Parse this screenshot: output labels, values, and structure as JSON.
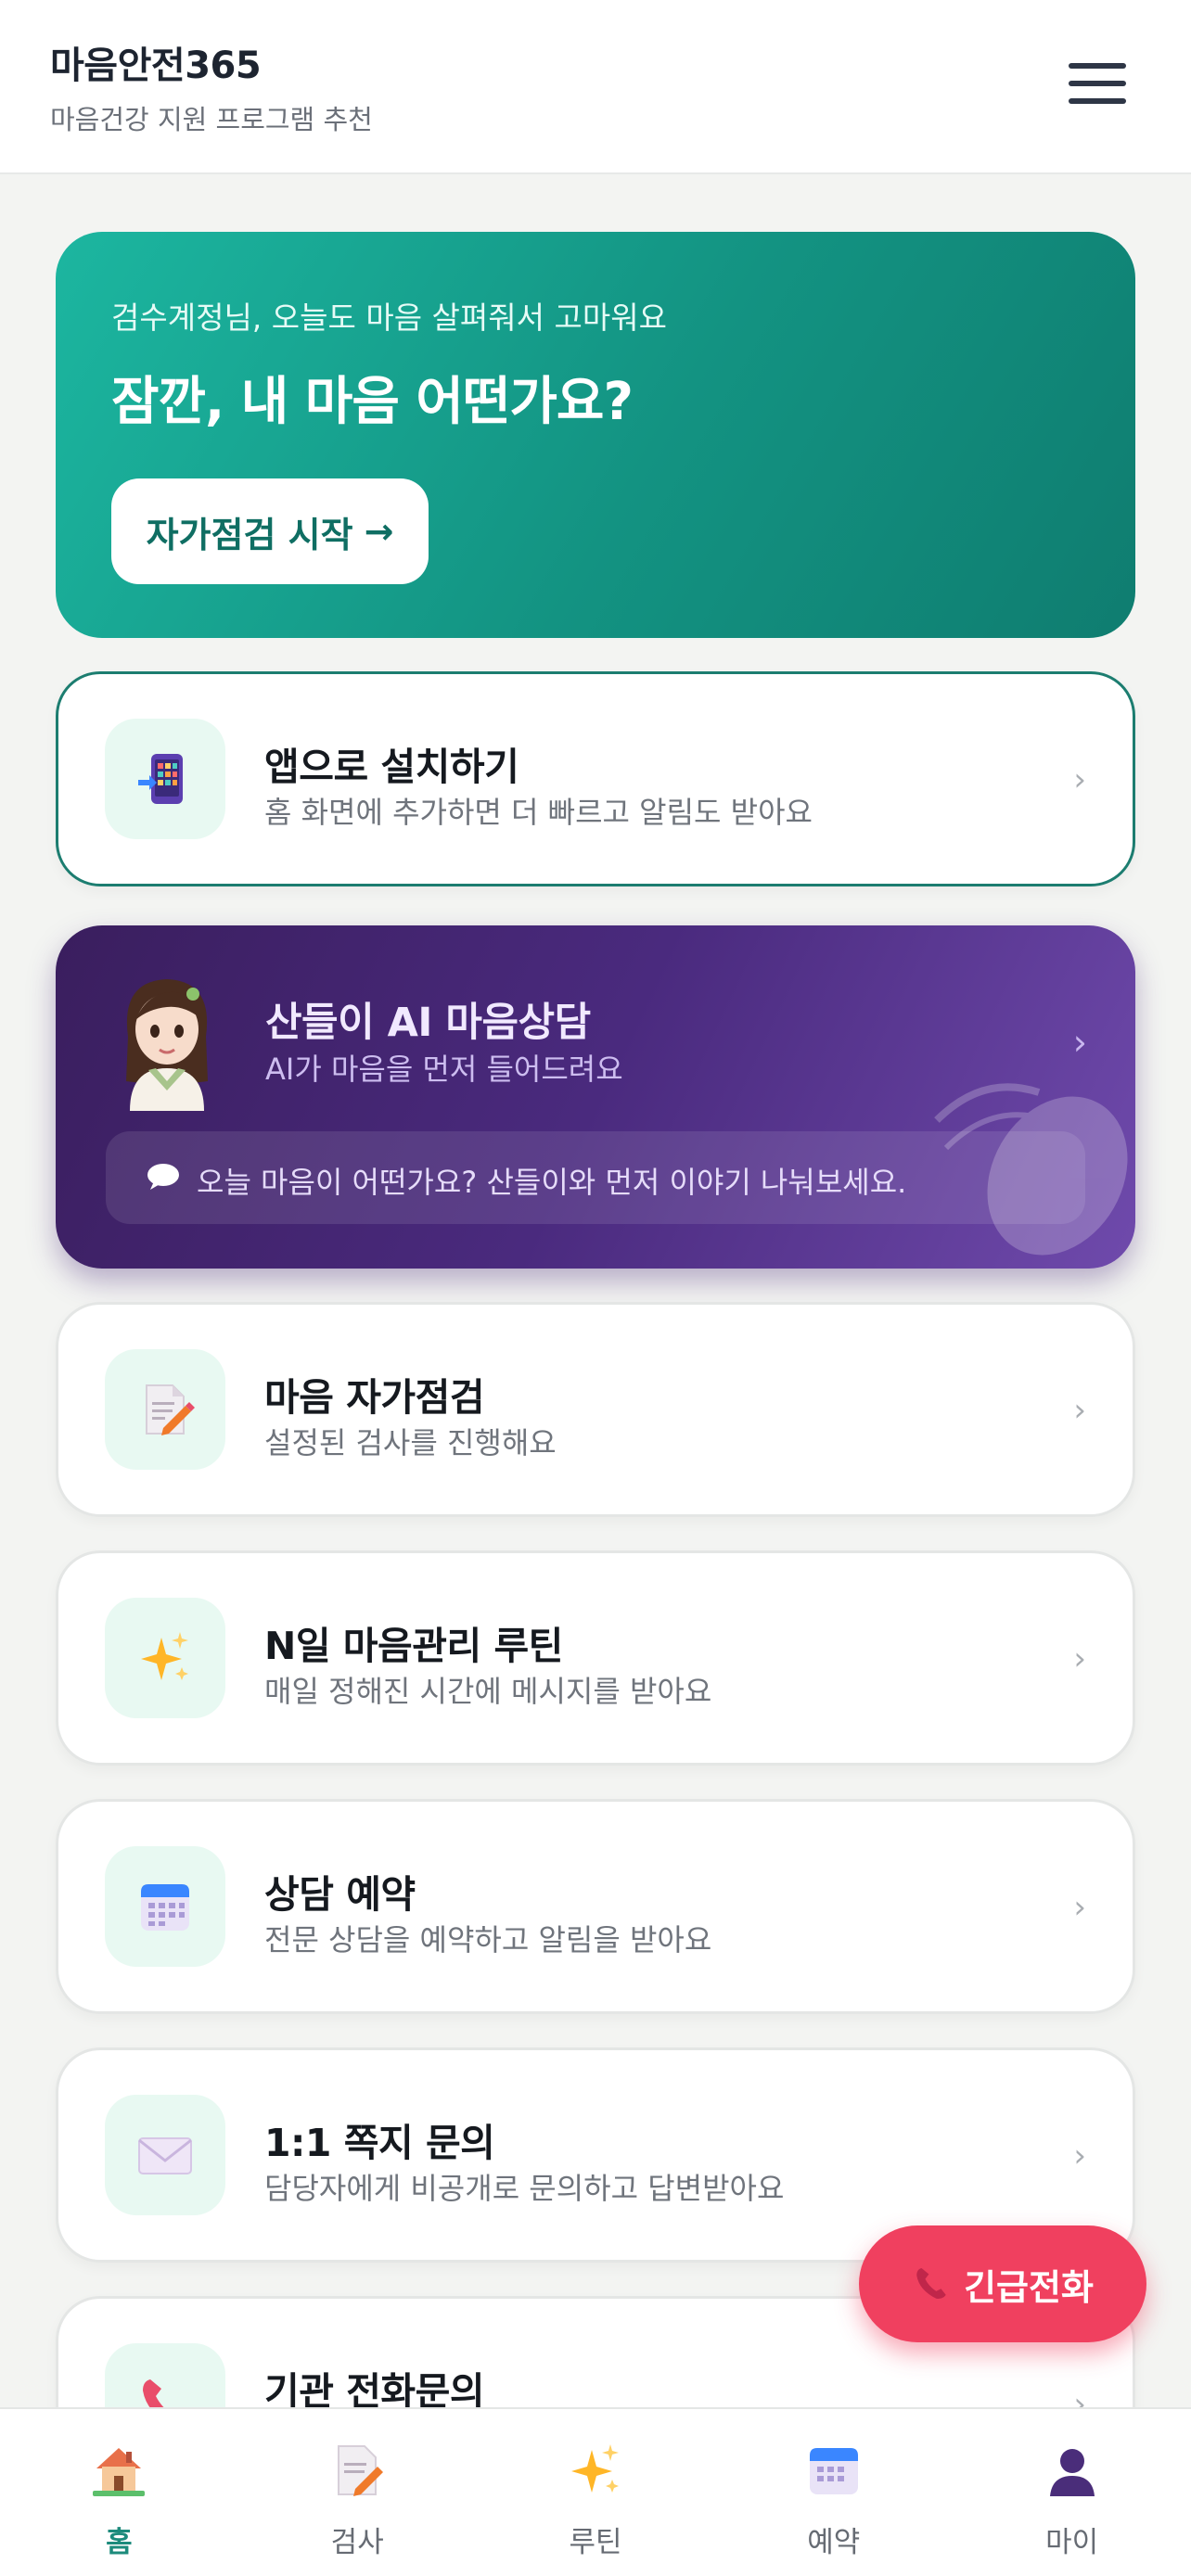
{
  "header": {
    "title": "마음안전365",
    "subtitle": "마음건강 지원 프로그램 추천"
  },
  "hero": {
    "greeting": "검수계정님, 오늘도 마음 살펴줘서 고마워요",
    "title": "잠깐, 내 마음 어떤가요?",
    "button_label": "자가점검 시작",
    "button_arrow": "→"
  },
  "install_card": {
    "title": "앱으로 설치하기",
    "desc": "홈 화면에 추가하면 더 빠르고 알림도 받아요",
    "chevron": "›",
    "icon": "phone-app-icon"
  },
  "ai_card": {
    "title": "산들이 AI 마음상담",
    "desc": "AI가 마음을 먼저 들어드려요",
    "chevron": "›",
    "bubble_text": "오늘 마음이 어떤가요? 산들이와 먼저 이야기 나눠보세요.",
    "bubble_icon": "chat-bubble-icon",
    "avatar": "sandeuli-avatar"
  },
  "cards": [
    {
      "title": "마음 자가점검",
      "desc": "설정된 검사를 진행해요",
      "chevron": "›",
      "icon": "memo-icon"
    },
    {
      "title": "N일 마음관리 루틴",
      "desc": "매일 정해진 시간에 메시지를 받아요",
      "chevron": "›",
      "icon": "sparkles-icon"
    },
    {
      "title": "상담 예약",
      "desc": "전문 상담을 예약하고 알림을 받아요",
      "chevron": "›",
      "icon": "calendar-icon"
    },
    {
      "title": "1:1 쪽지 문의",
      "desc": "담당자에게 비공개로 문의하고 답변받아요",
      "chevron": "›",
      "icon": "envelope-icon"
    },
    {
      "title": "기관 전화문의",
      "desc": "",
      "chevron": "›",
      "icon": "phone-icon"
    }
  ],
  "fab": {
    "label": "긴급전화",
    "icon": "phone-icon",
    "color": "#f0405f"
  },
  "bottom_nav": {
    "items": [
      {
        "label": "홈",
        "icon": "home-icon",
        "active": true
      },
      {
        "label": "검사",
        "icon": "memo-icon",
        "active": false
      },
      {
        "label": "루틴",
        "icon": "sparkles-icon",
        "active": false
      },
      {
        "label": "예약",
        "icon": "calendar-icon",
        "active": false
      },
      {
        "label": "마이",
        "icon": "person-icon",
        "active": false
      }
    ]
  },
  "colors": {
    "accent": "#1d8b7c",
    "hero_start": "#1cb6a0",
    "hero_end": "#0f7d70",
    "ai_start": "#3a1e5e",
    "ai_end": "#6f4aac",
    "emergency": "#f0405f"
  }
}
